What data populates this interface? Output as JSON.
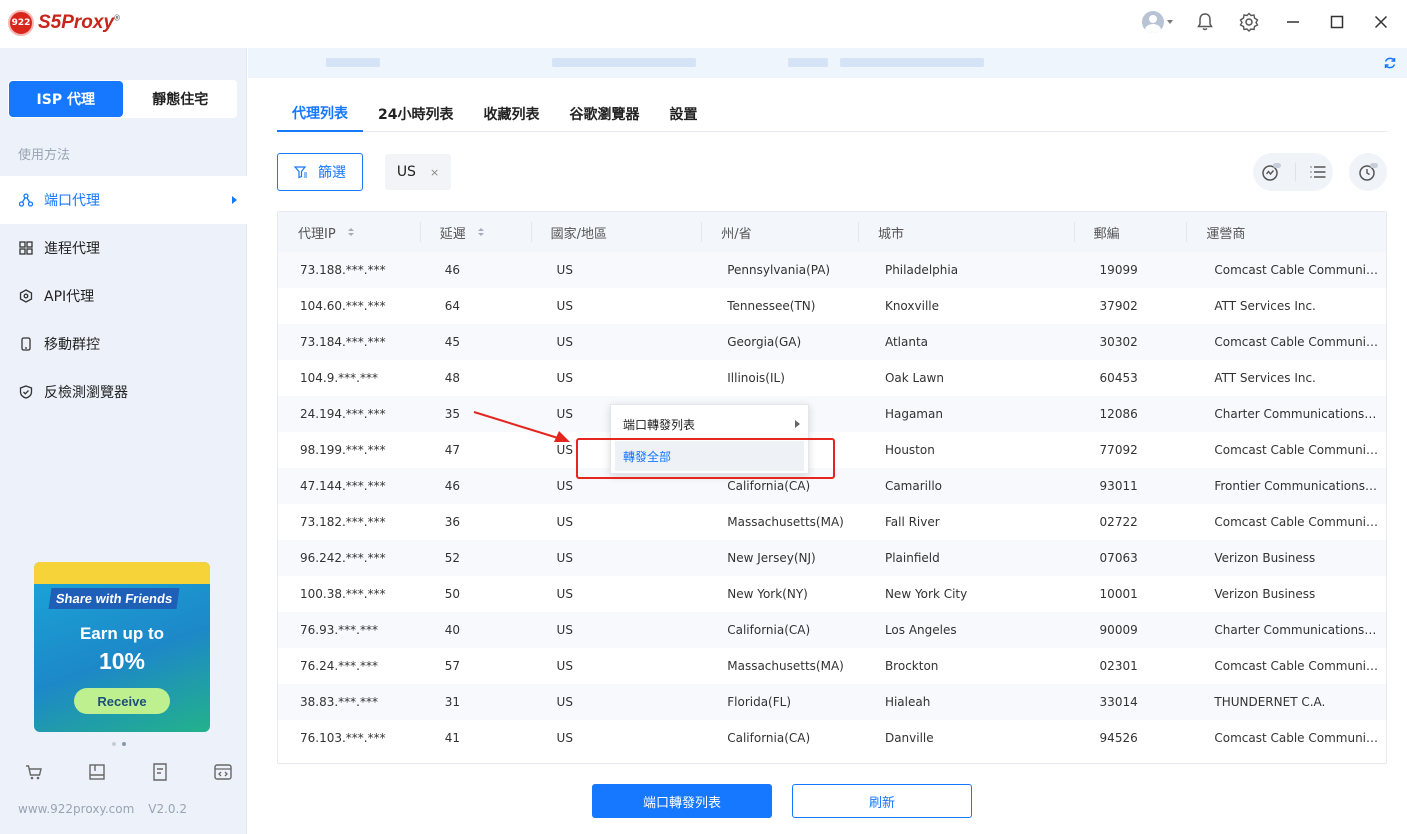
{
  "app": {
    "logo_badge": "922",
    "logo_name": "S5Proxy",
    "logo_mark": "®"
  },
  "sidebar": {
    "types": [
      "ISP 代理",
      "靜態住宅"
    ],
    "usage_label": "使用方法",
    "nav": [
      {
        "label": "端口代理",
        "icon": "network-icon",
        "active": true
      },
      {
        "label": "進程代理",
        "icon": "grid-icon",
        "active": false
      },
      {
        "label": "API代理",
        "icon": "api-icon",
        "active": false
      },
      {
        "label": "移動群控",
        "icon": "phone-icon",
        "active": false
      },
      {
        "label": "反檢測瀏覽器",
        "icon": "shield-icon",
        "active": false
      }
    ],
    "promo": {
      "share": "Share with Friends",
      "earn": "Earn up to",
      "percent": "10%",
      "button": "Receive"
    },
    "footer": {
      "site": "www.922proxy.com",
      "version": "V2.0.2"
    }
  },
  "tabs": [
    "代理列表",
    "24小時列表",
    "收藏列表",
    "谷歌瀏覽器",
    "設置"
  ],
  "filter": {
    "button_label": "篩選",
    "tag": "US",
    "tag_close": "×"
  },
  "table": {
    "columns": [
      "代理IP",
      "延遲",
      "國家/地區",
      "州/省",
      "城市",
      "郵編",
      "運營商"
    ],
    "rows": [
      [
        "73.188.***.***",
        "46",
        "US",
        "Pennsylvania(PA)",
        "Philadelphia",
        "19099",
        "Comcast Cable Communications"
      ],
      [
        "104.60.***.***",
        "64",
        "US",
        "Tennessee(TN)",
        "Knoxville",
        "37902",
        "ATT Services Inc."
      ],
      [
        "73.184.***.***",
        "45",
        "US",
        "Georgia(GA)",
        "Atlanta",
        "30302",
        "Comcast Cable Communications"
      ],
      [
        "104.9.***.***",
        "48",
        "US",
        "Illinois(IL)",
        "Oak Lawn",
        "60453",
        "ATT Services Inc."
      ],
      [
        "24.194.***.***",
        "35",
        "US",
        "",
        "Hagaman",
        "12086",
        "Charter Communications Inc"
      ],
      [
        "98.199.***.***",
        "47",
        "US",
        "",
        "Houston",
        "77092",
        "Comcast Cable Communications"
      ],
      [
        "47.144.***.***",
        "46",
        "US",
        "California(CA)",
        "Camarillo",
        "93011",
        "Frontier Communications Corporation"
      ],
      [
        "73.182.***.***",
        "36",
        "US",
        "Massachusetts(MA)",
        "Fall River",
        "02722",
        "Comcast Cable Communications"
      ],
      [
        "96.242.***.***",
        "52",
        "US",
        "New Jersey(NJ)",
        "Plainfield",
        "07063",
        "Verizon Business"
      ],
      [
        "100.38.***.***",
        "50",
        "US",
        "New York(NY)",
        "New York City",
        "10001",
        "Verizon Business"
      ],
      [
        "76.93.***.***",
        "40",
        "US",
        "California(CA)",
        "Los Angeles",
        "90009",
        "Charter Communications Inc"
      ],
      [
        "76.24.***.***",
        "57",
        "US",
        "Massachusetts(MA)",
        "Brockton",
        "02301",
        "Comcast Cable Communications"
      ],
      [
        "38.83.***.***",
        "31",
        "US",
        "Florida(FL)",
        "Hialeah",
        "33014",
        "THUNDERNET C.A."
      ],
      [
        "76.103.***.***",
        "41",
        "US",
        "California(CA)",
        "Danville",
        "94526",
        "Comcast Cable Communications"
      ]
    ]
  },
  "context_menu": {
    "items": [
      "端口轉發列表",
      "轉發全部"
    ]
  },
  "buttons": {
    "forward_list": "端口轉發列表",
    "refresh": "刷新"
  },
  "colors": {
    "accent": "#1677ff",
    "highlight_box": "#e5261e"
  }
}
